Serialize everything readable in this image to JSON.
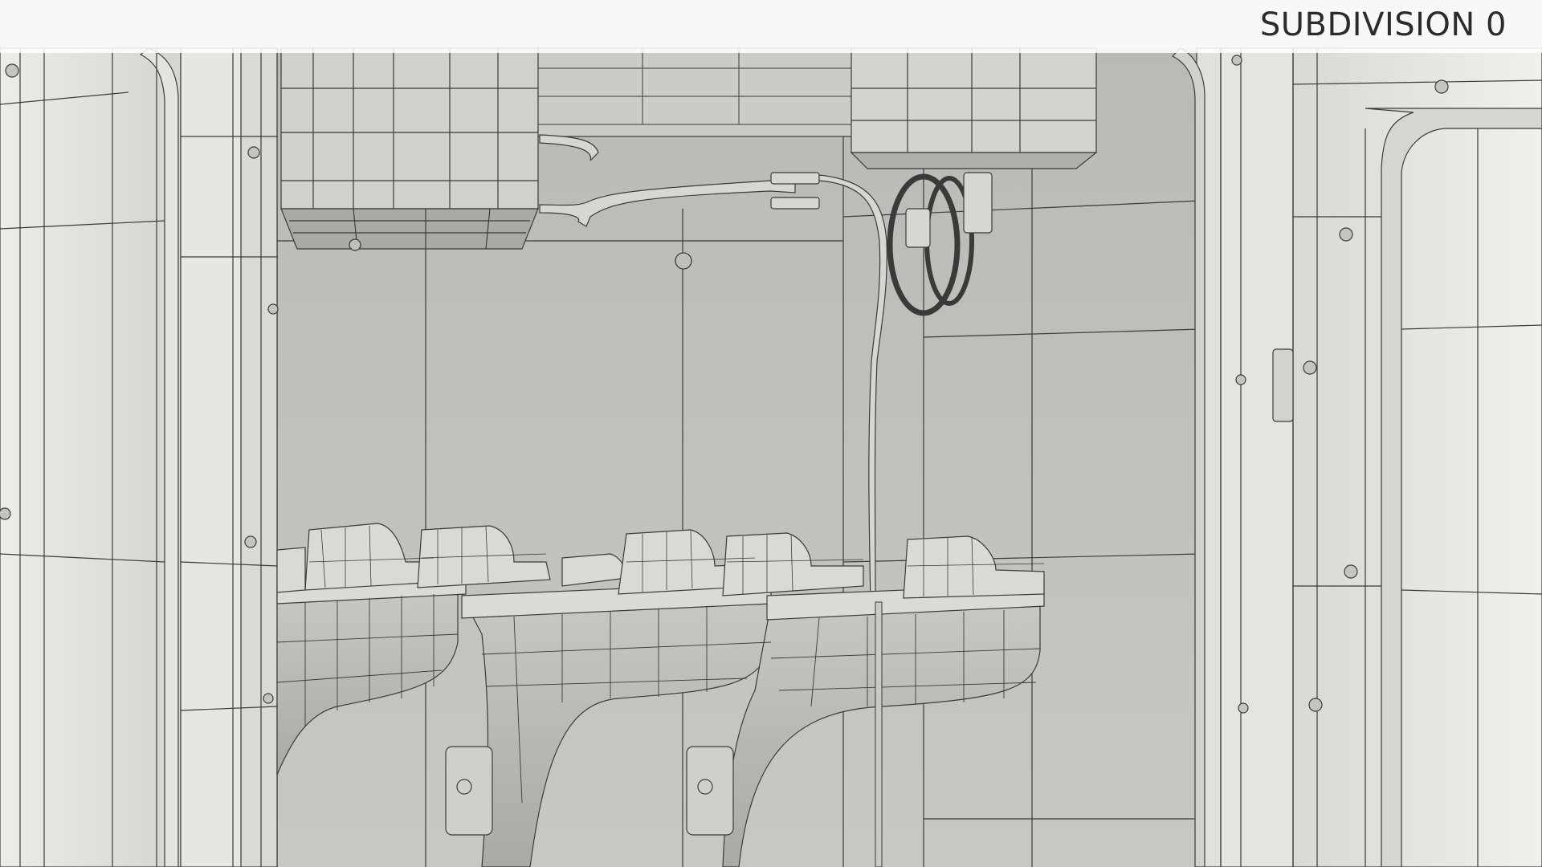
{
  "render_label": "SUBDIVISION 0",
  "scene": {
    "description_icon": "wireframe-render",
    "colors": {
      "wall": "#cfd0cc",
      "panel_light": "#e9e9e5",
      "panel_mid": "#bdbeba",
      "wire": "#3a3b39",
      "label_bar": "#ffffff",
      "label_text": "#2b2b2b"
    }
  }
}
